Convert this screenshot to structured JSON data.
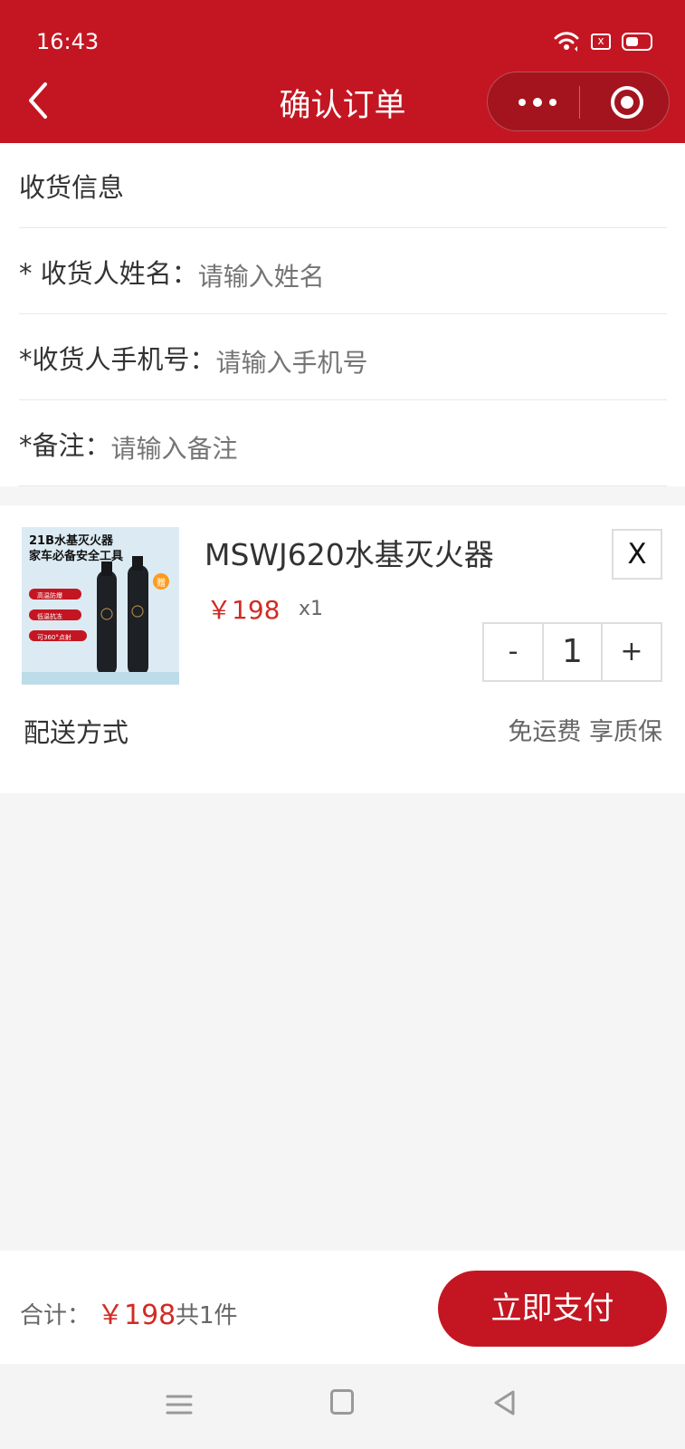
{
  "status": {
    "time": "16:43",
    "battery_badge": "x"
  },
  "header": {
    "title": "确认订单"
  },
  "receiving": {
    "title": "收货信息",
    "name_label": "* 收货人姓名：",
    "name_placeholder": "请输入姓名",
    "phone_label": "*收货人手机号：",
    "phone_placeholder": "请输入手机号",
    "note_label": "*备注：",
    "note_placeholder": "请输入备注"
  },
  "product": {
    "name": "MSWJ620水基灭火器",
    "price": "￥198",
    "qty_text": "x1",
    "remove_label": "X",
    "minus": "-",
    "quantity": "1",
    "plus": "+",
    "image_text": {
      "line1": "21B水基灭火器",
      "line2": "家车必备安全工具",
      "badge1": "高温防爆",
      "badge2": "低温抗冻",
      "badge3": "可360°点射",
      "sticker": "赠"
    }
  },
  "delivery": {
    "label": "配送方式",
    "value": "免运费 享质保"
  },
  "footer": {
    "total_label": "合计：",
    "total_price": "￥198",
    "total_count": "共1件",
    "pay_label": "立即支付"
  },
  "colors": {
    "primary": "#c41622",
    "price": "#d12b25"
  },
  "icons": [
    "wifi-icon",
    "battery-icon",
    "back-arrow-icon",
    "more-icon",
    "target-icon",
    "menu-icon",
    "home-icon",
    "back-icon"
  ]
}
